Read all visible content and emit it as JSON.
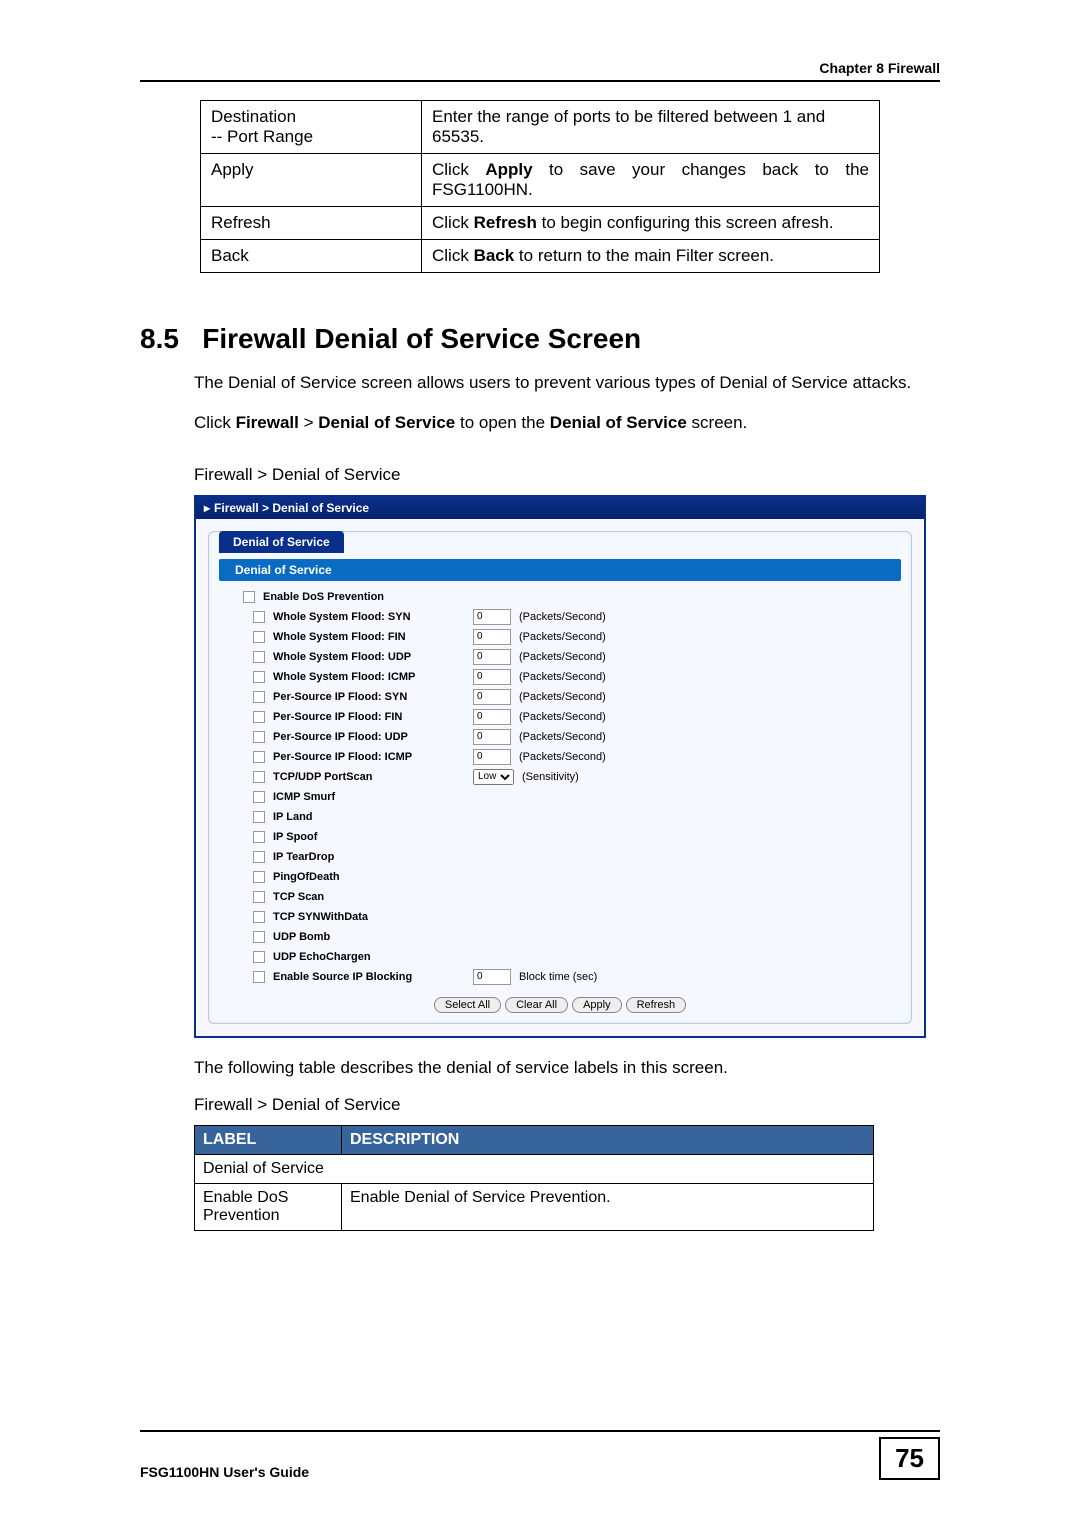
{
  "header": {
    "chapter": "Chapter 8 Firewall"
  },
  "filter_table": {
    "rows": [
      {
        "label": "Destination\n-- Port Range",
        "desc_plain": "Enter the range of ports to be filtered between 1 and 65535."
      },
      {
        "label": "Apply",
        "desc_pre": "Click ",
        "desc_bold": "Apply",
        "desc_post": " to save your changes back to the FSG1100HN."
      },
      {
        "label": "Refresh",
        "desc_pre": "Click ",
        "desc_bold": "Refresh",
        "desc_post": " to begin configuring this screen afresh."
      },
      {
        "label": "Back",
        "desc_pre": "Click ",
        "desc_bold": "Back",
        "desc_post": " to return to the main Filter screen."
      }
    ]
  },
  "section": {
    "number": "8.5",
    "title": "Firewall Denial of Service Screen",
    "intro": "The Denial of Service screen allows users to prevent various types of Denial of Service attacks.",
    "nav_pre": "Click ",
    "nav_bold1": "Firewall",
    "nav_gt": " > ",
    "nav_bold2": "Denial of Service",
    "nav_mid": " to open the ",
    "nav_bold3": "Denial of Service",
    "nav_post": " screen.",
    "caption": "Firewall > Denial of Service"
  },
  "dos": {
    "breadcrumb": "Firewall > Denial of Service",
    "tab": "Denial of Service",
    "subheader": "Denial of Service",
    "enable_label": "Enable DoS Prevention",
    "packets_unit": "(Packets/Second)",
    "sensitivity_unit": "(Sensitivity)",
    "sensitivity_value": "Low",
    "block_time_unit": "Block time (sec)",
    "default_value": "0",
    "rows": [
      {
        "label": "Whole System Flood: SYN",
        "input": true
      },
      {
        "label": "Whole System Flood: FIN",
        "input": true
      },
      {
        "label": "Whole System Flood: UDP",
        "input": true
      },
      {
        "label": "Whole System Flood: ICMP",
        "input": true
      },
      {
        "label": "Per-Source IP Flood: SYN",
        "input": true
      },
      {
        "label": "Per-Source IP Flood: FIN",
        "input": true
      },
      {
        "label": "Per-Source IP Flood: UDP",
        "input": true
      },
      {
        "label": "Per-Source IP Flood: ICMP",
        "input": true
      },
      {
        "label": "TCP/UDP PortScan",
        "select": true
      },
      {
        "label": "ICMP Smurf"
      },
      {
        "label": "IP Land"
      },
      {
        "label": "IP Spoof"
      },
      {
        "label": "IP TearDrop"
      },
      {
        "label": "PingOfDeath"
      },
      {
        "label": "TCP Scan"
      },
      {
        "label": "TCP SYNWithData"
      },
      {
        "label": "UDP Bomb"
      },
      {
        "label": "UDP EchoChargen"
      },
      {
        "label": "Enable Source IP Blocking",
        "block": true
      }
    ],
    "buttons": [
      "Select All",
      "Clear All",
      "Apply",
      "Refresh"
    ]
  },
  "after_text": "The following table describes the denial of service labels in this screen.",
  "desc_caption": "Firewall > Denial of Service",
  "desc_table": {
    "headers": [
      "LABEL",
      "DESCRIPTION"
    ],
    "section_row": "Denial of Service",
    "rows": [
      {
        "label": "Enable DoS Prevention",
        "desc": "Enable Denial of Service Prevention."
      }
    ]
  },
  "footer": {
    "guide": "FSG1100HN User's Guide",
    "page": "75"
  }
}
